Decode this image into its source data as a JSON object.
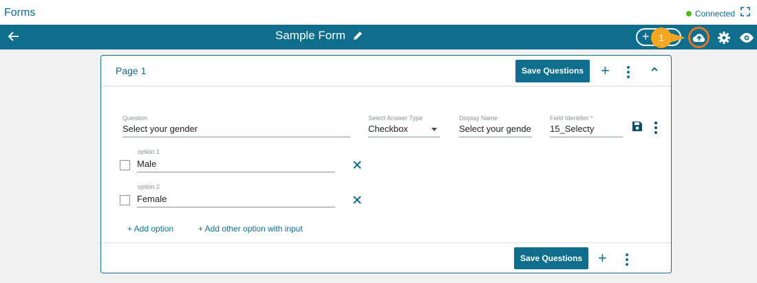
{
  "app": {
    "title": "Forms",
    "status": "Connected"
  },
  "header": {
    "form_title": "Sample Form",
    "add_label": "+",
    "badge": "1"
  },
  "page": {
    "label": "Page 1",
    "save_label": "Save Questions",
    "footer_save_label": "Save Questions"
  },
  "question": {
    "question_label": "Question",
    "question_value": "Select your gender",
    "answer_type_label": "Select Answer Type",
    "answer_type_value": "Checkbox",
    "display_name_label": "Display Name",
    "display_name_value": "Select your gende",
    "field_id_label": "Field Identifier *",
    "field_id_value": "15_Selecty"
  },
  "options": [
    {
      "label": "option 1",
      "value": "Male"
    },
    {
      "label": "option 2",
      "value": "Female"
    }
  ],
  "links": {
    "add_option": "+ Add option",
    "add_other": "+ Add other option with input"
  },
  "colors": {
    "primary": "#0f6e8c",
    "highlight": "#e87722",
    "badge": "#f5a623",
    "status": "#4cbb17"
  },
  "icons": [
    "back-arrow-icon",
    "pencil-icon",
    "cloud-upload-icon",
    "gear-icon",
    "eye-icon",
    "floppy-icon",
    "close-icon",
    "fullscreen-icon"
  ]
}
